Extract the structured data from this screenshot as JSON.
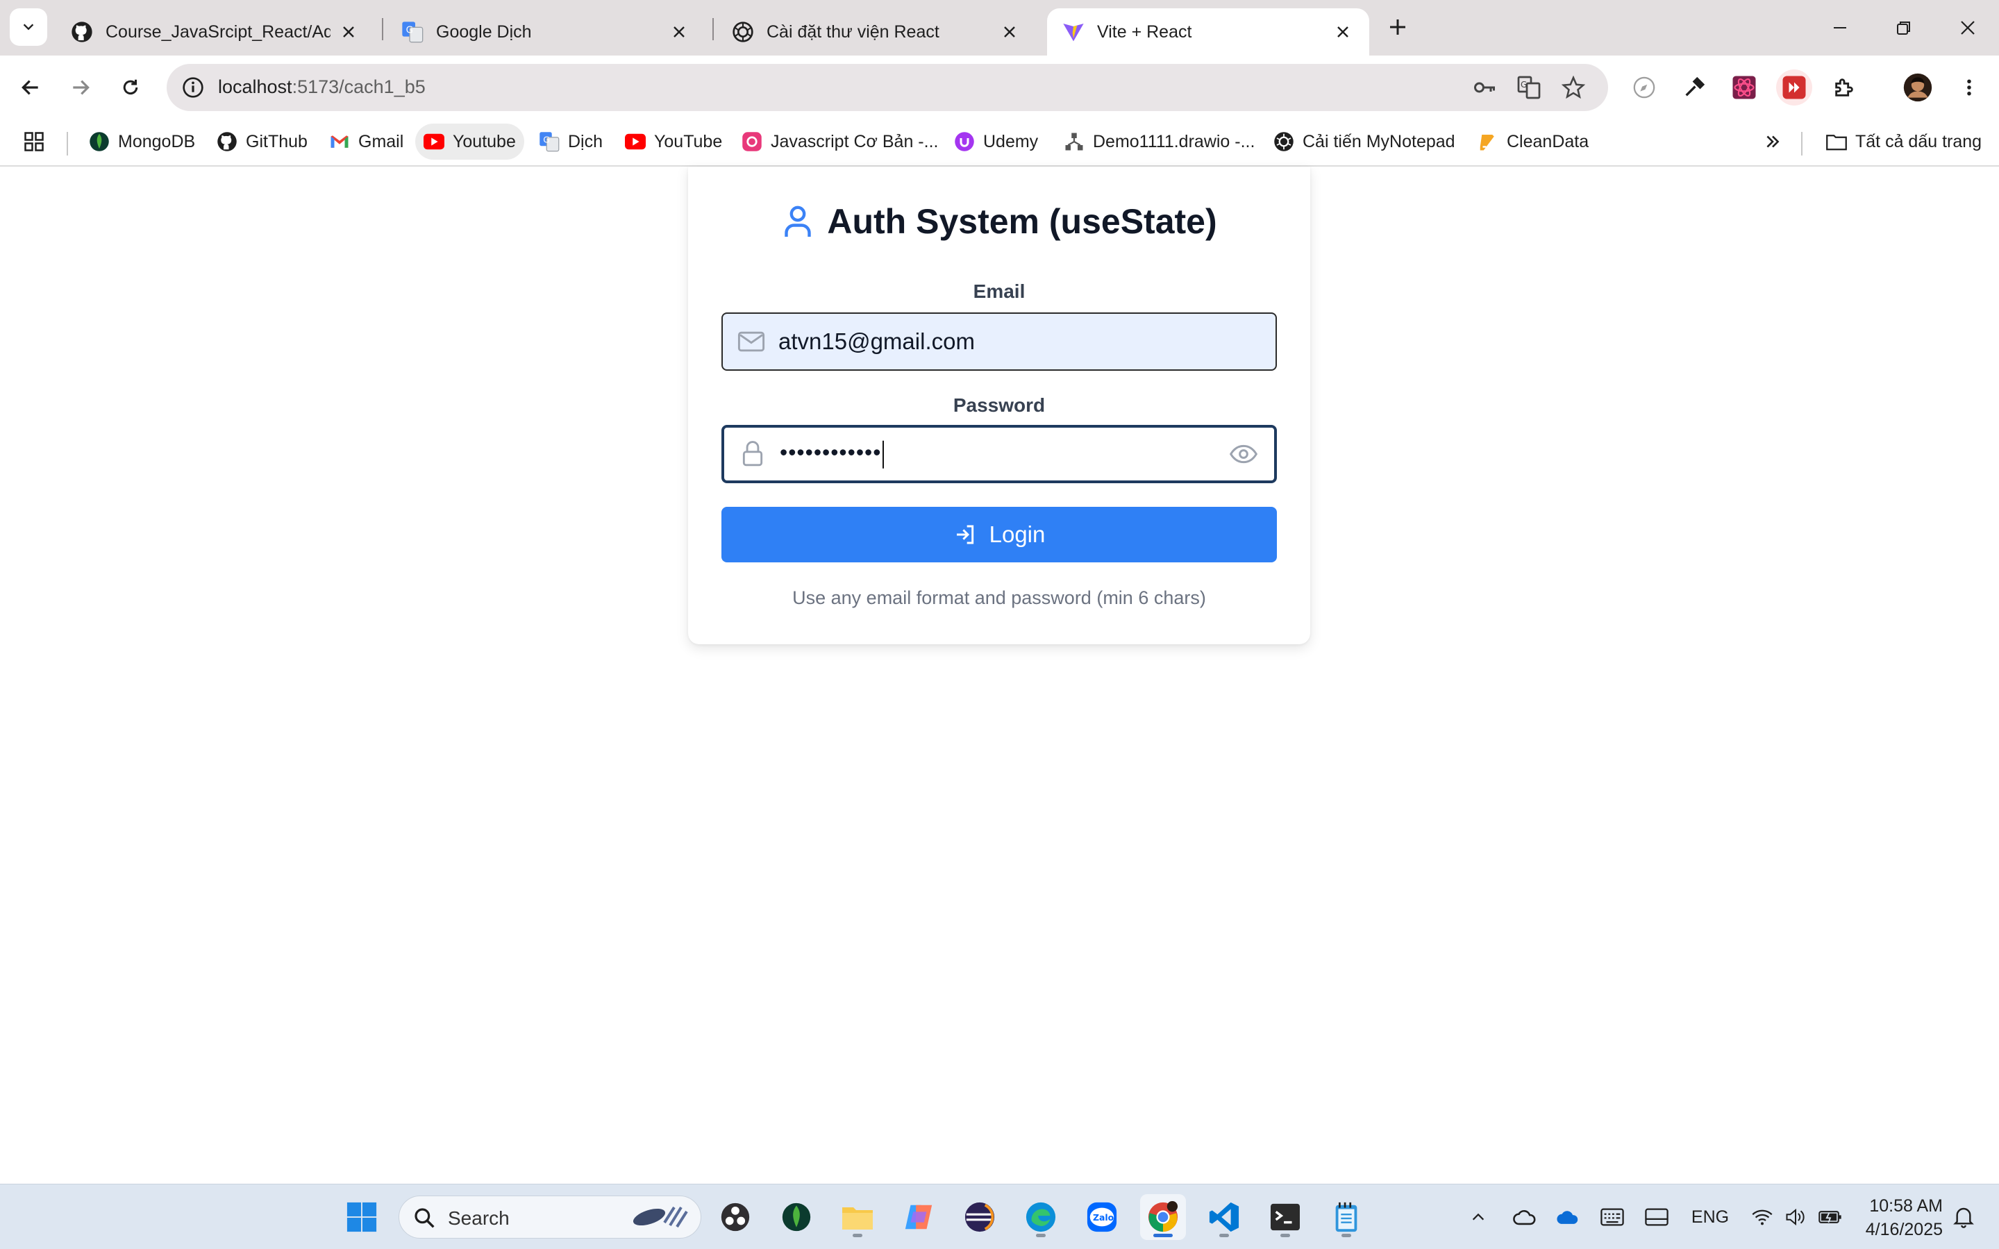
{
  "browser": {
    "tabs": [
      {
        "title": "Course_JavaSrcipt_React/Admin",
        "icon": "github-icon",
        "active": false
      },
      {
        "title": "Google Dịch",
        "icon": "google-translate-icon",
        "active": false
      },
      {
        "title": "Cài đặt thư viện React",
        "icon": "openai-icon",
        "active": false
      },
      {
        "title": "Vite + React",
        "icon": "vite-icon",
        "active": true
      }
    ],
    "url_host": "localhost",
    "url_path": ":5173/cach1_b5",
    "bookmarks": [
      {
        "label": "MongoDB",
        "icon": "mongodb-icon"
      },
      {
        "label": "GitThub",
        "icon": "github-icon"
      },
      {
        "label": "Gmail",
        "icon": "gmail-icon"
      },
      {
        "label": "Youtube",
        "icon": "youtube-icon"
      },
      {
        "label": "Dịch",
        "icon": "google-translate-icon"
      },
      {
        "label": "YouTube",
        "icon": "youtube-icon"
      },
      {
        "label": "Javascript Cơ Bản -...",
        "icon": "bookmark-icon"
      },
      {
        "label": "Udemy",
        "icon": "udemy-icon"
      },
      {
        "label": "Demo1111.drawio -...",
        "icon": "drawio-icon"
      },
      {
        "label": "Cải tiến MyNotepad",
        "icon": "openai-icon"
      },
      {
        "label": "CleanData",
        "icon": "cleandata-icon"
      }
    ],
    "all_bookmarks": "Tất cả dấu trang"
  },
  "page": {
    "title": "Auth System (useState)",
    "email_label": "Email",
    "email_value": "atvn15@gmail.com",
    "password_label": "Password",
    "password_value": "••••••••••••",
    "login_label": "Login",
    "hint": "Use any email format and password (min 6 chars)"
  },
  "taskbar": {
    "search_label": "Search",
    "language": "ENG",
    "time": "10:58 AM",
    "date": "4/16/2025"
  },
  "colors": {
    "accent": "#2f80f5",
    "title_icon": "#3b82f6",
    "email_bg": "#e8f0fe"
  }
}
